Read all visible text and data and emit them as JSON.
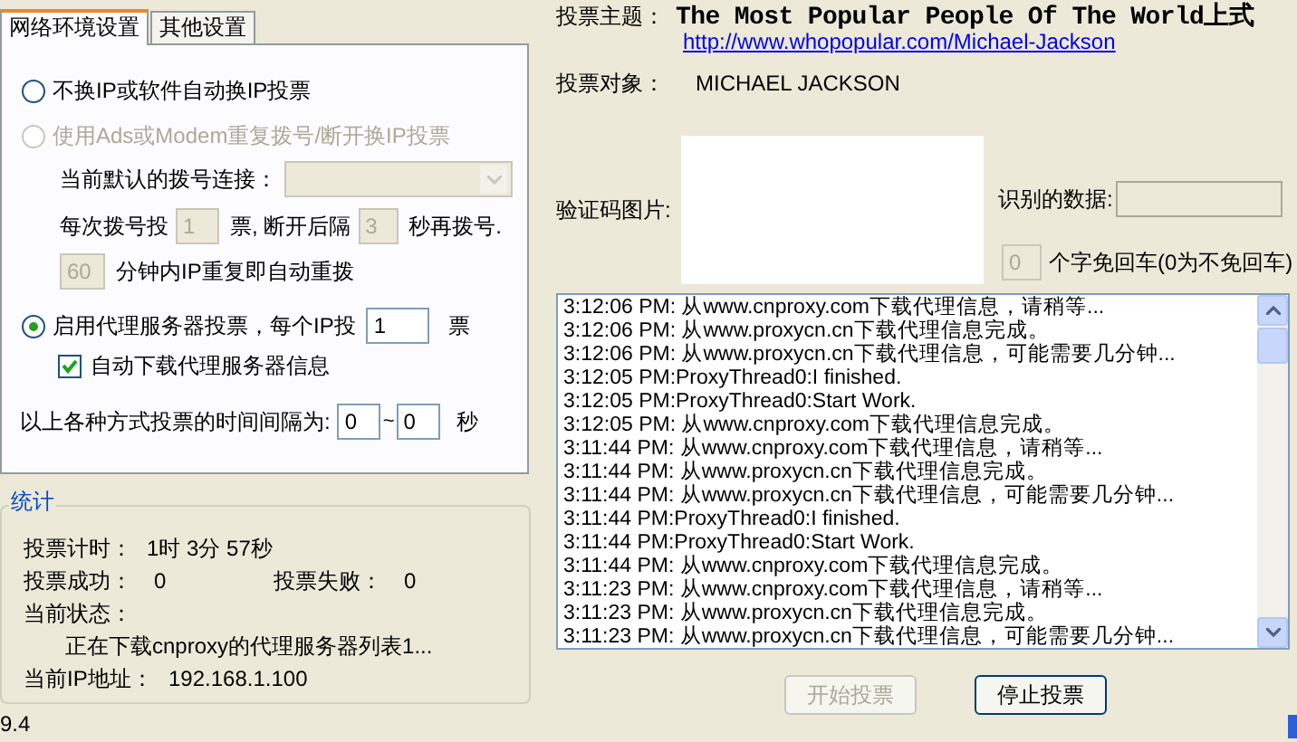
{
  "tabs": [
    {
      "label": "网络环境设置",
      "selected": true
    },
    {
      "label": "其他设置",
      "selected": false
    }
  ],
  "ip_options": [
    {
      "label": "不换IP或软件自动换IP投票",
      "selected": false,
      "disabled": false
    },
    {
      "label": "使用Ads或Modem重复拨号/断开换IP投票",
      "selected": false,
      "disabled": true
    },
    {
      "label": "启用代理服务器投票，每个IP投",
      "selected": true,
      "disabled": false
    }
  ],
  "dial": {
    "disabled": true,
    "connection_label": "当前默认的拨号连接：",
    "votes_prefix": "每次拨号投",
    "votes_value": "1",
    "votes_suffix": "票, 断开后隔",
    "interval_value": "3",
    "interval_suffix": "秒再拨号.",
    "repeat_value": "60",
    "repeat_suffix": "分钟内IP重复即自动重拨"
  },
  "proxy": {
    "votes_value": "1",
    "votes_suffix": "票",
    "auto_download": {
      "label": "自动下载代理服务器信息",
      "checked": true
    }
  },
  "interval": {
    "label": "以上各种方式投票的时间间隔为:",
    "from": "0",
    "separator": "~",
    "to": "0",
    "unit": "秒"
  },
  "stats": {
    "title": "统计",
    "timer_label": "投票计时：",
    "timer": "1时 3分 57秒",
    "success_label": "投票成功：",
    "success": "0",
    "fail_label": "投票失败：",
    "fail": "0",
    "status_label": "当前状态：",
    "status": "正在下载cnproxy的代理服务器列表1...",
    "ip_label": "当前IP地址：",
    "ip": "192.168.1.100"
  },
  "version_fragment": "9.4",
  "vote": {
    "topic_label": "投票主题：",
    "topic": "The Most Popular People Of The World上式",
    "url": "http://www.whopopular.com/Michael-Jackson",
    "target_label": "投票对象：",
    "target": "MICHAEL JACKSON",
    "captcha_label": "验证码图片:",
    "recognized_label": "识别的数据:",
    "auto_enter_value": "0",
    "auto_enter_label": "个字免回车(0为不免回车)"
  },
  "log": [
    "3:12:06 PM: 从www.cnproxy.com下载代理信息，请稍等...",
    "3:12:06 PM: 从www.proxycn.cn下载代理信息完成。",
    "3:12:06 PM: 从www.proxycn.cn下载代理信息，可能需要几分钟...",
    "3:12:05 PM:ProxyThread0:I finished.",
    "3:12:05 PM:ProxyThread0:Start Work.",
    "3:12:05 PM: 从www.cnproxy.com下载代理信息完成。",
    "3:11:44 PM: 从www.cnproxy.com下载代理信息，请稍等...",
    "3:11:44 PM: 从www.proxycn.cn下载代理信息完成。",
    "3:11:44 PM: 从www.proxycn.cn下载代理信息，可能需要几分钟...",
    "3:11:44 PM:ProxyThread0:I finished.",
    "3:11:44 PM:ProxyThread0:Start Work.",
    "3:11:44 PM: 从www.cnproxy.com下载代理信息完成。",
    "3:11:23 PM: 从www.cnproxy.com下载代理信息，请稍等...",
    "3:11:23 PM: 从www.proxycn.cn下载代理信息完成。",
    "3:11:23 PM: 从www.proxycn.cn下载代理信息，可能需要几分钟..."
  ],
  "buttons": [
    {
      "label": "开始投票",
      "disabled": true
    },
    {
      "label": "停止投票",
      "disabled": false
    }
  ]
}
